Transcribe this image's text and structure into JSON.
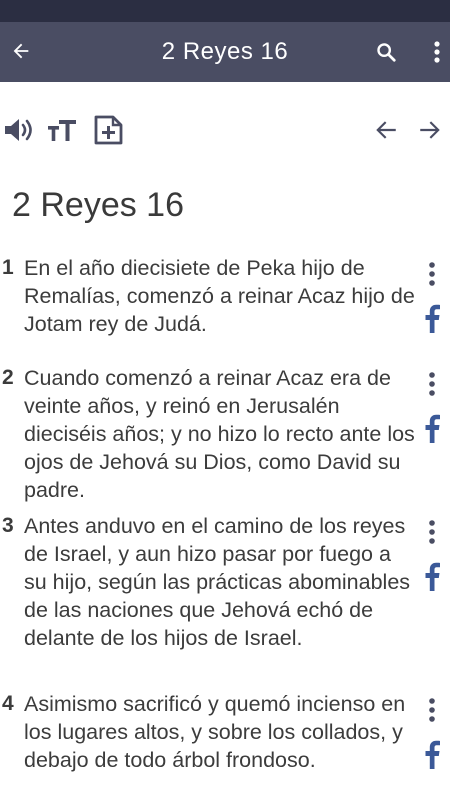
{
  "app_bar": {
    "title": "2 Reyes 16",
    "back_icon": "arrow-left-icon",
    "search_icon": "search-icon",
    "more_icon": "more-vertical-icon",
    "background": "#4a4d63",
    "status_bar_color": "#2b2e42"
  },
  "toolbar": {
    "icons": [
      "speaker-icon",
      "text-size-icon",
      "add-note-icon",
      "previous-chapter-icon",
      "next-chapter-icon"
    ]
  },
  "chapter": {
    "title": "2 Reyes 16"
  },
  "verses": [
    {
      "number": "1",
      "text": "En el año diecisiete de Peka hijo de Remalías, comenzó a reinar Acaz hijo de Jotam rey de Judá."
    },
    {
      "number": "2",
      "text": "Cuando comenzó a reinar Acaz era de veinte años, y reinó en Jerusalén dieciséis años; y no hizo lo recto ante los ojos de Jehová su Dios, como David su padre."
    },
    {
      "number": "3",
      "text": "Antes anduvo en el camino de los reyes de Israel, y aun hizo pasar por fuego a su hijo, según las prácticas abominables de las naciones que Jehová echó de delante de los hijos de Israel."
    },
    {
      "number": "4",
      "text": "Asimismo sacrificó y quemó incienso en los lugares altos, y sobre los collados, y debajo de todo árbol frondoso."
    }
  ],
  "colors": {
    "facebook": "#3b5998",
    "icon_dark": "#4a4d63"
  }
}
